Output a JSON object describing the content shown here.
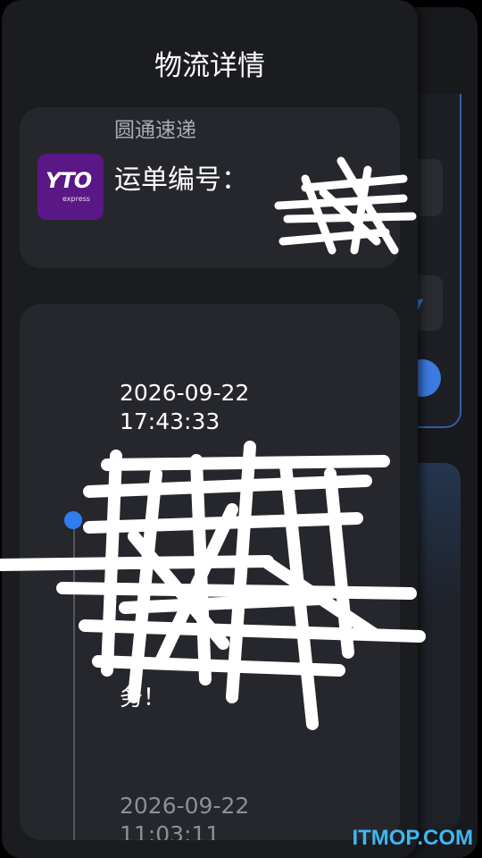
{
  "page": {
    "title": "物流详情"
  },
  "courier": {
    "name": "圆通速递",
    "logo_text": "YTO",
    "logo_sub": "express",
    "waybill_label": "运单编号：",
    "brand_color": "#5a1786"
  },
  "timeline": {
    "events": [
      {
        "date": "2026-09-22",
        "time": "17:43:33",
        "desc": "务！"
      },
      {
        "date": "2026-09-22",
        "time": "11:03:11"
      }
    ],
    "active_dot_color": "#2f7ef0"
  },
  "watermark": "ITMOP.COM"
}
